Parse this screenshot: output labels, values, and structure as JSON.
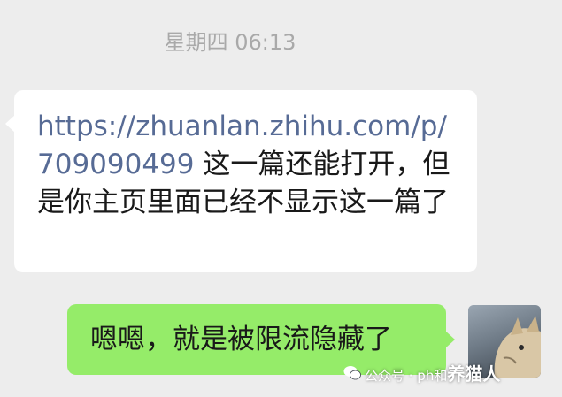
{
  "chat": {
    "timestamp": "星期四 06:13",
    "incoming": {
      "link": "https://zhuanlan.zhihu.com/p/709090499",
      "text": " 这一篇还能打开，但是你主页里面已经不显示这一篇了"
    },
    "outgoing": {
      "text": "嗯嗯，就是被限流隐藏了"
    }
  },
  "watermark": {
    "icon": "wechat-official-account-icon",
    "prefix": "公众号 · ph和",
    "name": "养猫人"
  },
  "colors": {
    "background": "#ededed",
    "incoming_bubble": "#ffffff",
    "outgoing_bubble": "#95ec69",
    "link": "#576b95",
    "timestamp": "#a9a9a9"
  }
}
